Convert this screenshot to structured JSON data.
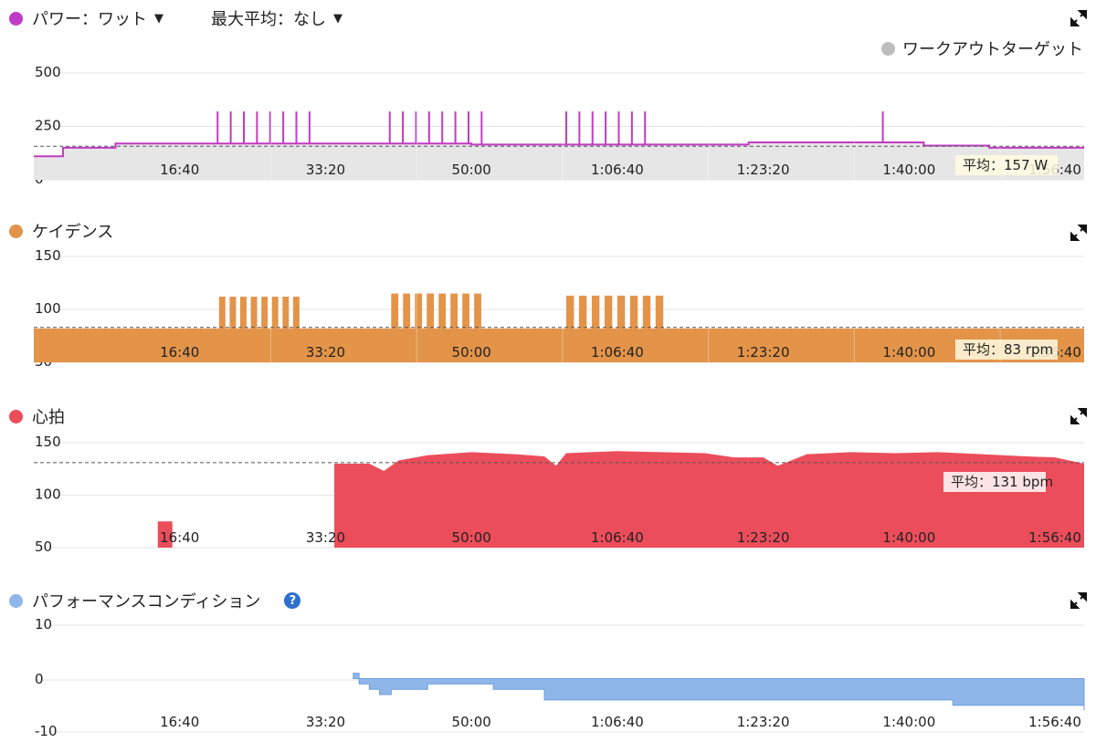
{
  "colors": {
    "power": "#c23bc4",
    "power_fill": "#e6e6e6",
    "cadence": "#e39449",
    "heart": "#ec4d5b",
    "condition": "#8fb6e8",
    "target": "#bdbdbd",
    "help": "#2d6fd0"
  },
  "power_panel": {
    "title": "パワー：ワット",
    "average_mode_label": "最大平均：なし",
    "legend_target": "ワークアウトターゲット",
    "avg_label": "平均：157 W",
    "icon": "expand-icon"
  },
  "cadence_panel": {
    "title": "ケイデンス",
    "avg_label": "平均：83 rpm",
    "icon": "expand-icon"
  },
  "heart_panel": {
    "title": "心拍",
    "avg_label": "平均：131 bpm",
    "icon": "expand-icon"
  },
  "condition_panel": {
    "title": "パフォーマンスコンディション",
    "help_label": "?",
    "icon": "expand-icon"
  },
  "chart_data": [
    {
      "type": "area",
      "series": [
        {
          "name": "パワー：ワット"
        }
      ],
      "y_ticks": [
        "500",
        "250",
        "0"
      ],
      "ylim": [
        0,
        500
      ],
      "x_ticks": [
        "16:40",
        "33:20",
        "50:00",
        "1:06:40",
        "1:23:20",
        "1:40:00",
        "1:56:40"
      ],
      "x_tick_seconds": [
        1000,
        2000,
        3000,
        4000,
        5000,
        6000,
        7000
      ],
      "x_range_seconds": [
        0,
        7200
      ],
      "average": 157,
      "segments": [
        {
          "start": 0,
          "end": 200,
          "value": 110
        },
        {
          "start": 200,
          "end": 560,
          "value": 150
        },
        {
          "start": 560,
          "end": 3000,
          "value": 170
        },
        {
          "start": 3000,
          "end": 4900,
          "value": 165
        },
        {
          "start": 4900,
          "end": 6100,
          "value": 175
        },
        {
          "start": 6100,
          "end": 6550,
          "value": 160
        },
        {
          "start": 6550,
          "end": 7200,
          "value": 150
        }
      ],
      "spikes": [
        1260,
        1350,
        1440,
        1530,
        1620,
        1710,
        1800,
        1890,
        2440,
        2530,
        2620,
        2710,
        2800,
        2890,
        2980,
        3070,
        3650,
        3740,
        3830,
        3920,
        4010,
        4100,
        4190,
        5820
      ],
      "spike_value": 320
    },
    {
      "type": "area",
      "series": [
        {
          "name": "ケイデンス"
        }
      ],
      "y_ticks": [
        "150",
        "100",
        "50"
      ],
      "ylim": [
        50,
        150
      ],
      "x_ticks": [
        "16:40",
        "33:20",
        "50:00",
        "1:06:40",
        "1:23:20",
        "1:40:00",
        "1:56:40"
      ],
      "x_tick_seconds": [
        1000,
        2000,
        3000,
        4000,
        5000,
        6000,
        7000
      ],
      "x_range_seconds": [
        0,
        7200
      ],
      "average": 83,
      "baseline": 82,
      "blocks": [
        {
          "start": 1270,
          "end": 1850,
          "count": 8,
          "value": 112
        },
        {
          "start": 2450,
          "end": 3100,
          "count": 8,
          "value": 115
        },
        {
          "start": 3650,
          "end": 4350,
          "count": 8,
          "value": 113
        }
      ]
    },
    {
      "type": "area",
      "series": [
        {
          "name": "心拍"
        }
      ],
      "y_ticks": [
        "150",
        "100",
        "50"
      ],
      "ylim": [
        50,
        150
      ],
      "x_ticks": [
        "16:40",
        "33:20",
        "50:00",
        "1:06:40",
        "1:23:20",
        "1:40:00",
        "1:56:40"
      ],
      "x_tick_seconds": [
        1000,
        2000,
        3000,
        4000,
        5000,
        6000,
        7000
      ],
      "x_range_seconds": [
        0,
        7200
      ],
      "average": 131,
      "points": [
        [
          850,
          0
        ],
        [
          850,
          75
        ],
        [
          950,
          75
        ],
        [
          950,
          0
        ],
        [
          2060,
          0
        ],
        [
          2060,
          130
        ],
        [
          2300,
          130
        ],
        [
          2400,
          123
        ],
        [
          2500,
          133
        ],
        [
          2700,
          138
        ],
        [
          3000,
          141
        ],
        [
          3300,
          139
        ],
        [
          3500,
          137
        ],
        [
          3580,
          128
        ],
        [
          3650,
          140
        ],
        [
          4000,
          142
        ],
        [
          4300,
          141
        ],
        [
          4600,
          140
        ],
        [
          4800,
          136
        ],
        [
          5000,
          136
        ],
        [
          5100,
          128
        ],
        [
          5300,
          139
        ],
        [
          5600,
          141
        ],
        [
          5900,
          140
        ],
        [
          6200,
          141
        ],
        [
          6500,
          139
        ],
        [
          6800,
          137
        ],
        [
          7000,
          136
        ],
        [
          7200,
          130
        ],
        [
          7200,
          0
        ]
      ]
    },
    {
      "type": "area",
      "series": [
        {
          "name": "パフォーマンスコンディション"
        }
      ],
      "y_ticks": [
        "10",
        "0",
        "-10"
      ],
      "ylim": [
        -10,
        10
      ],
      "x_ticks": [
        "16:40",
        "33:20",
        "50:00",
        "1:06:40",
        "1:23:20",
        "1:40:00",
        "1:56:40"
      ],
      "x_tick_seconds": [
        1000,
        2000,
        3000,
        4000,
        5000,
        6000,
        7000
      ],
      "x_range_seconds": [
        0,
        7200
      ],
      "steps": [
        [
          2190,
          1
        ],
        [
          2230,
          -1
        ],
        [
          2300,
          -2
        ],
        [
          2370,
          -3
        ],
        [
          2450,
          -2
        ],
        [
          2700,
          -1
        ],
        [
          3150,
          -2
        ],
        [
          3500,
          -4
        ],
        [
          5300,
          -4
        ],
        [
          5380,
          -4
        ],
        [
          5520,
          -4
        ],
        [
          6300,
          -5
        ],
        [
          7200,
          -6
        ]
      ]
    }
  ]
}
